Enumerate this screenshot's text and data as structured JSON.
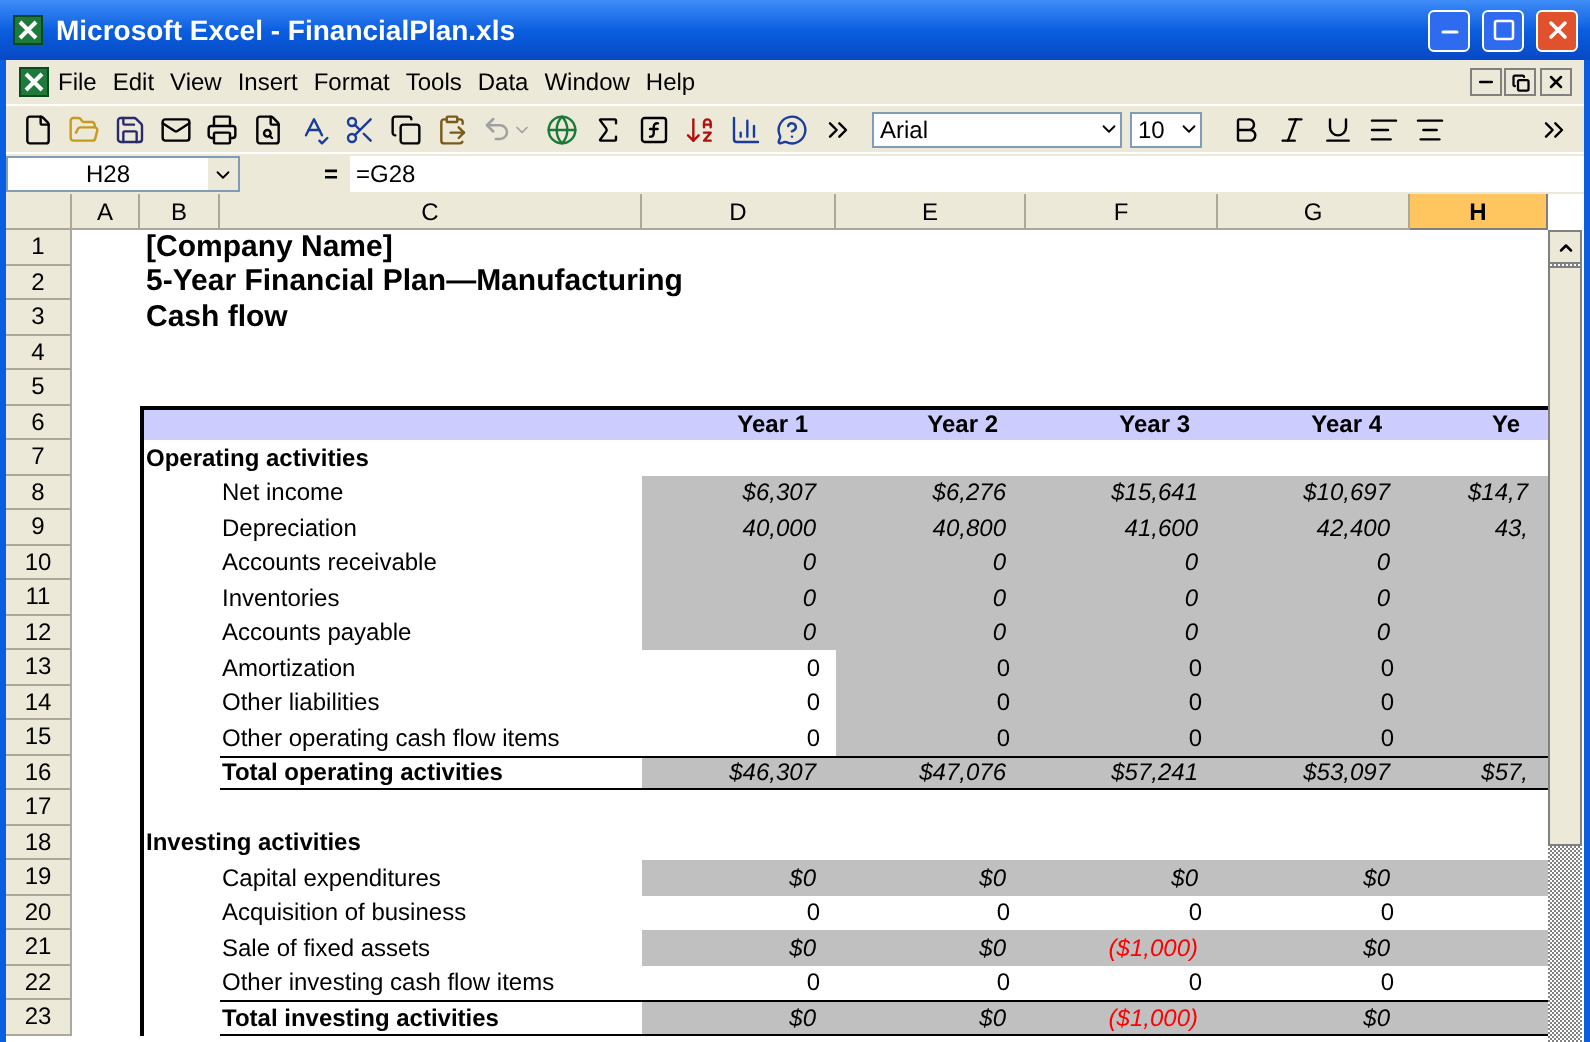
{
  "window": {
    "title": "Microsoft Excel - FinancialPlan.xls"
  },
  "menu": [
    "File",
    "Edit",
    "View",
    "Insert",
    "Format",
    "Tools",
    "Data",
    "Window",
    "Help"
  ],
  "toolbar": {
    "font": "Arial",
    "size": "10"
  },
  "formula_bar": {
    "name_box": "H28",
    "equals": "=",
    "formula": "=G28"
  },
  "columns": [
    {
      "label": "A",
      "selected": false
    },
    {
      "label": "B",
      "selected": false
    },
    {
      "label": "C",
      "selected": false
    },
    {
      "label": "D",
      "selected": false
    },
    {
      "label": "E",
      "selected": false
    },
    {
      "label": "F",
      "selected": false
    },
    {
      "label": "G",
      "selected": false
    },
    {
      "label": "H",
      "selected": true
    }
  ],
  "rows": [
    {
      "number": "1",
      "kind": "title",
      "label": "[Company Name]"
    },
    {
      "number": "2",
      "kind": "title",
      "label": "5-Year Financial Plan—Manufacturing"
    },
    {
      "number": "3",
      "kind": "title",
      "label": "Cash flow"
    },
    {
      "number": "4",
      "kind": "blank"
    },
    {
      "number": "5",
      "kind": "blank"
    },
    {
      "number": "6",
      "kind": "header",
      "years": [
        "Year 1",
        "Year 2",
        "Year 3",
        "Year 4",
        "Ye"
      ]
    },
    {
      "number": "7",
      "kind": "section",
      "label": "Operating activities"
    },
    {
      "number": "8",
      "kind": "item",
      "label": "Net income",
      "italic": true,
      "cells": [
        {
          "text": "$6,307",
          "shaded": true,
          "negative": false
        },
        {
          "text": "$6,276",
          "shaded": true,
          "negative": false
        },
        {
          "text": "$15,641",
          "shaded": true,
          "negative": false
        },
        {
          "text": "$10,697",
          "shaded": true,
          "negative": false
        },
        {
          "text": "$14,7",
          "shaded": true,
          "negative": false
        }
      ]
    },
    {
      "number": "9",
      "kind": "item",
      "label": "Depreciation",
      "italic": true,
      "cells": [
        {
          "text": "40,000",
          "shaded": true,
          "negative": false
        },
        {
          "text": "40,800",
          "shaded": true,
          "negative": false
        },
        {
          "text": "41,600",
          "shaded": true,
          "negative": false
        },
        {
          "text": "42,400",
          "shaded": true,
          "negative": false
        },
        {
          "text": "43,",
          "shaded": true,
          "negative": false
        }
      ]
    },
    {
      "number": "10",
      "kind": "item",
      "label": "Accounts receivable",
      "italic": true,
      "cells": [
        {
          "text": "0",
          "shaded": true,
          "negative": false
        },
        {
          "text": "0",
          "shaded": true,
          "negative": false
        },
        {
          "text": "0",
          "shaded": true,
          "negative": false
        },
        {
          "text": "0",
          "shaded": true,
          "negative": false
        },
        {
          "shaded": true,
          "negative": false
        }
      ]
    },
    {
      "number": "11",
      "kind": "item",
      "label": "Inventories",
      "italic": true,
      "cells": [
        {
          "text": "0",
          "shaded": true,
          "negative": false
        },
        {
          "text": "0",
          "shaded": true,
          "negative": false
        },
        {
          "text": "0",
          "shaded": true,
          "negative": false
        },
        {
          "text": "0",
          "shaded": true,
          "negative": false
        },
        {
          "shaded": true,
          "negative": false
        }
      ]
    },
    {
      "number": "12",
      "kind": "item",
      "label": "Accounts payable",
      "italic": true,
      "cells": [
        {
          "text": "0",
          "shaded": true,
          "negative": false
        },
        {
          "text": "0",
          "shaded": true,
          "negative": false
        },
        {
          "text": "0",
          "shaded": true,
          "negative": false
        },
        {
          "text": "0",
          "shaded": true,
          "negative": false
        },
        {
          "shaded": true,
          "negative": false
        }
      ]
    },
    {
      "number": "13",
      "kind": "item",
      "label": "Amortization",
      "italic": false,
      "cells": [
        {
          "text": "0",
          "shaded": false,
          "negative": false
        },
        {
          "text": "0",
          "shaded": true,
          "negative": false
        },
        {
          "text": "0",
          "shaded": true,
          "negative": false
        },
        {
          "text": "0",
          "shaded": true,
          "negative": false
        },
        {
          "shaded": true,
          "negative": false
        }
      ]
    },
    {
      "number": "14",
      "kind": "item",
      "label": "Other liabilities",
      "italic": false,
      "cells": [
        {
          "text": "0",
          "shaded": false,
          "negative": false
        },
        {
          "text": "0",
          "shaded": true,
          "negative": false
        },
        {
          "text": "0",
          "shaded": true,
          "negative": false
        },
        {
          "text": "0",
          "shaded": true,
          "negative": false
        },
        {
          "shaded": true,
          "negative": false
        }
      ]
    },
    {
      "number": "15",
      "kind": "item",
      "label": "Other operating cash flow items",
      "italic": false,
      "cells": [
        {
          "text": "0",
          "shaded": false,
          "negative": false
        },
        {
          "text": "0",
          "shaded": true,
          "negative": false
        },
        {
          "text": "0",
          "shaded": true,
          "negative": false
        },
        {
          "text": "0",
          "shaded": true,
          "negative": false
        },
        {
          "shaded": true,
          "negative": false
        }
      ]
    },
    {
      "number": "16",
      "kind": "total",
      "label": "Total operating activities",
      "italic": true,
      "cells": [
        {
          "text": "$46,307",
          "shaded": true,
          "negative": false
        },
        {
          "text": "$47,076",
          "shaded": true,
          "negative": false
        },
        {
          "text": "$57,241",
          "shaded": true,
          "negative": false
        },
        {
          "text": "$53,097",
          "shaded": true,
          "negative": false
        },
        {
          "text": "$57,",
          "shaded": true,
          "negative": false
        }
      ]
    },
    {
      "number": "17",
      "kind": "spacer"
    },
    {
      "number": "18",
      "kind": "section",
      "label": "Investing activities"
    },
    {
      "number": "19",
      "kind": "item",
      "label": "Capital expenditures",
      "italic": true,
      "cells": [
        {
          "text": "$0",
          "shaded": true,
          "negative": false
        },
        {
          "text": "$0",
          "shaded": true,
          "negative": false
        },
        {
          "text": "$0",
          "shaded": true,
          "negative": false
        },
        {
          "text": "$0",
          "shaded": true,
          "negative": false
        },
        {
          "shaded": true,
          "negative": false
        }
      ]
    },
    {
      "number": "20",
      "kind": "item",
      "label": "Acquisition of business",
      "italic": false,
      "cells": [
        {
          "text": "0",
          "shaded": false,
          "negative": false
        },
        {
          "text": "0",
          "shaded": false,
          "negative": false
        },
        {
          "text": "0",
          "shaded": false,
          "negative": false
        },
        {
          "text": "0",
          "shaded": false,
          "negative": false
        },
        {
          "shaded": false
        }
      ]
    },
    {
      "number": "21",
      "kind": "item",
      "label": "Sale of fixed assets",
      "italic": true,
      "cells": [
        {
          "text": "$0",
          "shaded": true,
          "negative": false
        },
        {
          "text": "$0",
          "shaded": true,
          "negative": false
        },
        {
          "text": "($1,000)",
          "shaded": true,
          "negative": true
        },
        {
          "text": "$0",
          "shaded": true,
          "negative": false
        },
        {
          "shaded": true,
          "negative": false
        }
      ]
    },
    {
      "number": "22",
      "kind": "item",
      "label": "Other investing cash flow items",
      "italic": false,
      "cells": [
        {
          "text": "0",
          "shaded": false,
          "negative": false
        },
        {
          "text": "0",
          "shaded": false,
          "negative": false
        },
        {
          "text": "0",
          "shaded": false,
          "negative": false
        },
        {
          "text": "0",
          "shaded": false,
          "negative": false
        },
        {
          "shaded": false
        }
      ]
    },
    {
      "number": "23",
      "kind": "total",
      "label": "Total investing activities",
      "italic": true,
      "cells": [
        {
          "text": "$0",
          "shaded": true,
          "negative": false
        },
        {
          "text": "$0",
          "shaded": true,
          "negative": false
        },
        {
          "text": "($1,000)",
          "shaded": true,
          "negative": true
        },
        {
          "text": "$0",
          "shaded": true,
          "negative": false
        },
        {
          "shaded": true,
          "negative": false
        }
      ]
    }
  ]
}
